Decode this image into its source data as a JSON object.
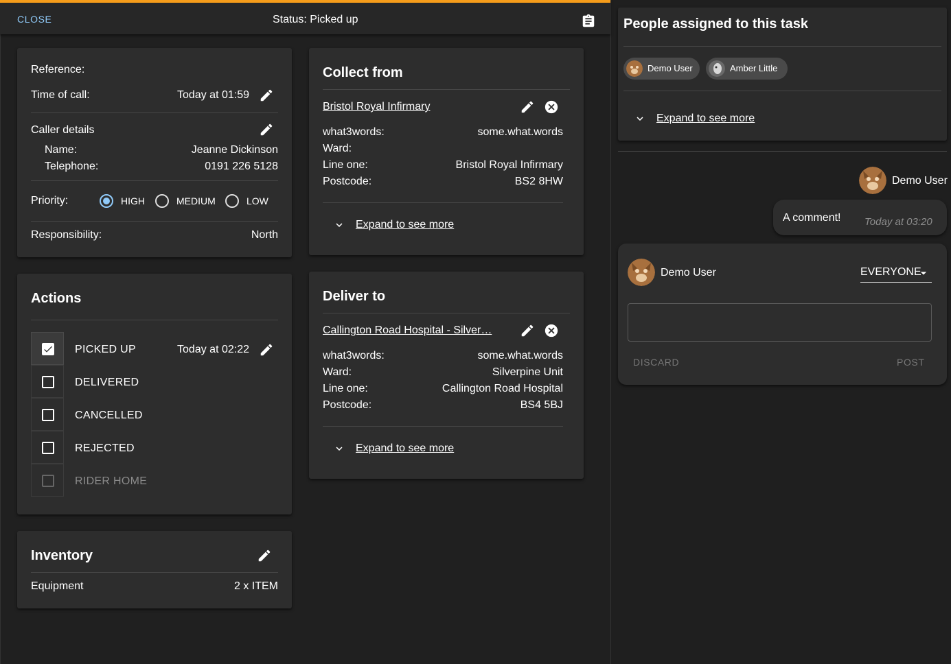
{
  "topbar": {
    "close_label": "CLOSE",
    "status": "Status: Picked up"
  },
  "details": {
    "reference_label": "Reference:",
    "time_of_call_label": "Time of call:",
    "time_of_call_value": "Today at 01:59",
    "caller_details_label": "Caller details",
    "name_label": "Name:",
    "name_value": "Jeanne Dickinson",
    "telephone_label": "Telephone:",
    "telephone_value": "0191 226 5128",
    "priority_label": "Priority:",
    "priority_options": [
      "HIGH",
      "MEDIUM",
      "LOW"
    ],
    "priority_selected": "HIGH",
    "responsibility_label": "Responsibility:",
    "responsibility_value": "North"
  },
  "actions": {
    "title": "Actions",
    "items": [
      {
        "label": "PICKED UP",
        "checked": true,
        "time": "Today at 02:22"
      },
      {
        "label": "DELIVERED",
        "checked": false
      },
      {
        "label": "CANCELLED",
        "checked": false
      },
      {
        "label": "REJECTED",
        "checked": false
      },
      {
        "label": "RIDER HOME",
        "checked": false,
        "disabled": true
      }
    ]
  },
  "inventory": {
    "title": "Inventory",
    "item_label": "Equipment",
    "item_value": "2 x ITEM"
  },
  "collect": {
    "title": "Collect from",
    "location_name": "Bristol Royal Infirmary",
    "w3w_label": "what3words:",
    "w3w_value": "some.what.words",
    "ward_label": "Ward:",
    "ward_value": "",
    "line_one_label": "Line one:",
    "line_one_value": "Bristol Royal Infirmary",
    "postcode_label": "Postcode:",
    "postcode_value": "BS2 8HW",
    "expand_label": "Expand to see more"
  },
  "deliver": {
    "title": "Deliver to",
    "location_name": "Callington Road Hospital - Silver…",
    "w3w_label": "what3words:",
    "w3w_value": "some.what.words",
    "ward_label": "Ward:",
    "ward_value": "Silverpine Unit",
    "line_one_label": "Line one:",
    "line_one_value": "Callington Road Hospital",
    "postcode_label": "Postcode:",
    "postcode_value": "BS4 5BJ",
    "expand_label": "Expand to see more"
  },
  "assigned": {
    "title": "People assigned to this task",
    "people": [
      "Demo User",
      "Amber Little"
    ],
    "expand_label": "Expand to see more"
  },
  "comment": {
    "author": "Demo User",
    "text": "A comment!",
    "time": "Today at 03:20"
  },
  "composer": {
    "author": "Demo User",
    "visibility": "EVERYONE",
    "input_value": "",
    "discard_label": "DISCARD",
    "post_label": "POST"
  },
  "colors": {
    "accent_top": "#f59c1a",
    "link_blue": "#90caf9",
    "card_bg": "#2d2d2d"
  }
}
